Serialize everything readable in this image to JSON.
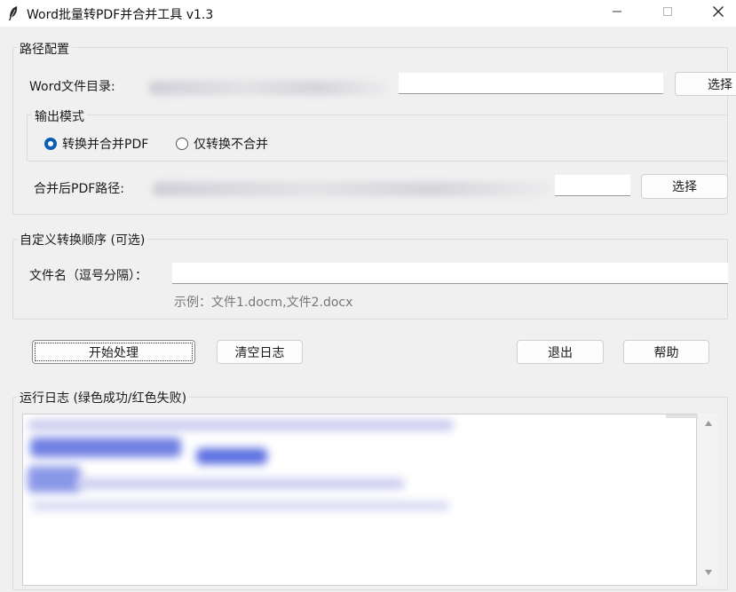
{
  "window": {
    "title": "Word批量转PDF并合并工具 v1.3",
    "icons": [
      "feather-icon",
      "minimize-icon",
      "maximize-icon",
      "close-icon"
    ]
  },
  "path_config": {
    "group_label": "路径配置",
    "word_dir_label": "Word文件目录:",
    "word_dir_value": "",
    "select_button_1": "选择",
    "output_mode": {
      "group_label": "输出模式",
      "option_merge": "转换并合并PDF",
      "option_convert_only": "仅转换不合并",
      "selected": "转换并合并PDF"
    },
    "merged_pdf_label": "合并后PDF路径:",
    "merged_pdf_value": "",
    "select_button_2": "选择"
  },
  "custom_order": {
    "group_label": "自定义转换顺序 (可选)",
    "filename_label": "文件名（逗号分隔）：",
    "filename_value": "",
    "example_hint": "示例：文件1.docm,文件2.docx"
  },
  "actions": {
    "start": "开始处理",
    "clear_log": "清空日志",
    "exit": "退出",
    "help": "帮助"
  },
  "log": {
    "group_label": "运行日志 (绿色成功/红色失败)"
  },
  "colors": {
    "accent": "#0a5fb4",
    "window_bg": "#f0f0f0",
    "log_blur_blue": "#5a6fe0"
  }
}
